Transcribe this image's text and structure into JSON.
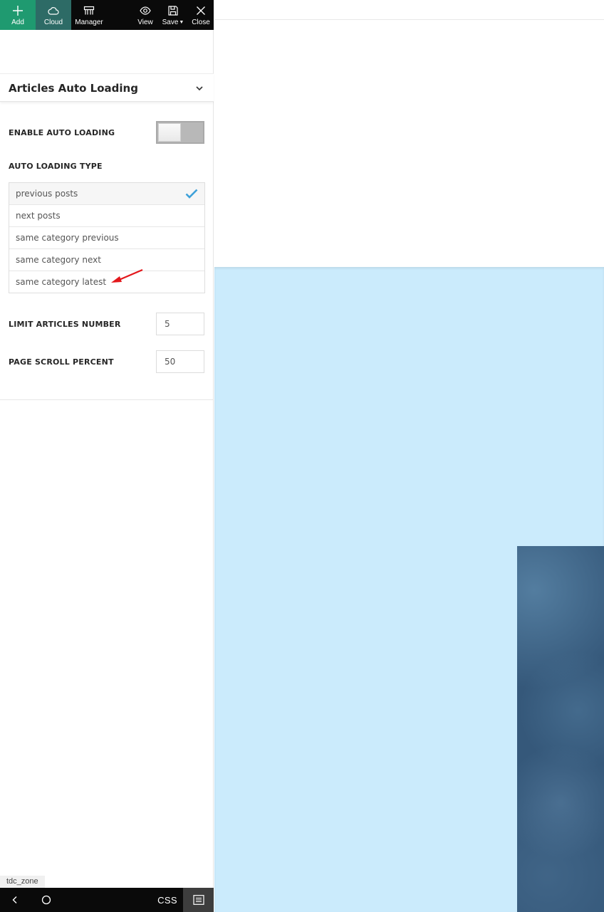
{
  "toolbar": {
    "add_label": "Add",
    "cloud_label": "Cloud",
    "manager_label": "Manager",
    "view_label": "View",
    "save_label": "Save",
    "close_label": "Close"
  },
  "section": {
    "title": "Articles Auto Loading"
  },
  "options": {
    "enable_label": "ENABLE AUTO LOADING",
    "enable_on": false,
    "type_label": "AUTO LOADING TYPE",
    "types": [
      {
        "label": "previous posts",
        "selected": true
      },
      {
        "label": "next posts",
        "selected": false
      },
      {
        "label": "same category previous",
        "selected": false
      },
      {
        "label": "same category next",
        "selected": false
      },
      {
        "label": "same category latest",
        "selected": false
      }
    ],
    "limit_label": "LIMIT ARTICLES NUMBER",
    "limit_value": "5",
    "scroll_label": "PAGE SCROLL PERCENT",
    "scroll_value": "50"
  },
  "zone_tag": "tdc_zone",
  "bottom_bar": {
    "css_label": "CSS"
  },
  "colors": {
    "add_bg": "#1f9a70",
    "cloud_bg": "#2d6b66",
    "toolbar_bg": "#0a0a0a",
    "check": "#3ea1d9",
    "annotation_arrow": "#e3171b",
    "preview_hero": "#cbebfc",
    "preview_image": "#35587a"
  }
}
